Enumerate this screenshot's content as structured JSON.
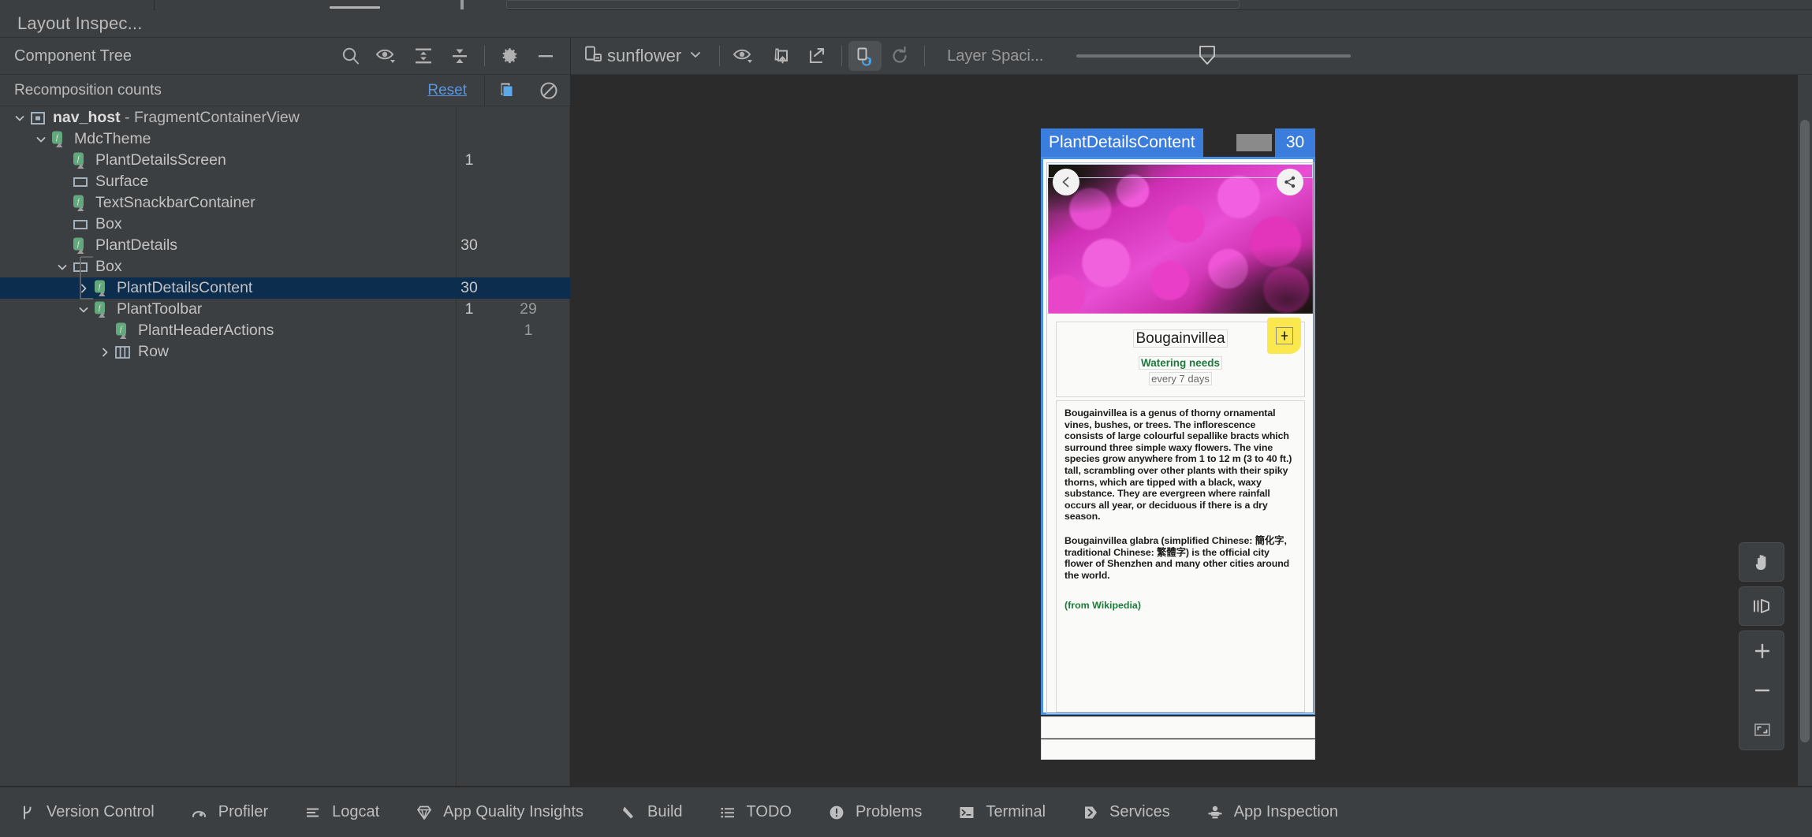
{
  "window": {
    "title": "Layout Inspec..."
  },
  "left_panel": {
    "header": "Component Tree",
    "toolbar": [
      {
        "name": "search-icon",
        "label": "Search"
      },
      {
        "name": "eye-dropdown-icon",
        "label": "Filter visibility"
      },
      {
        "name": "expand-all-icon",
        "label": "Expand All"
      },
      {
        "name": "collapse-all-icon",
        "label": "Collapse All"
      },
      {
        "name": "gear-icon",
        "label": "Settings"
      },
      {
        "name": "minimize-icon",
        "label": "Hide"
      }
    ],
    "recomposition": {
      "label": "Recomposition counts",
      "reset_label": "Reset",
      "highlight_icon": "recomposition-highlight-icon",
      "disable_icon": "recomposition-disable-icon"
    },
    "tree": [
      {
        "label": "nav_host",
        "suffix": " - FragmentContainerView",
        "icon": "view-node-icon",
        "depth": 0,
        "chevron": "down",
        "bold": true,
        "count1": "",
        "count2": ""
      },
      {
        "label": "MdcTheme",
        "suffix": "",
        "icon": "compose-node-icon",
        "depth": 1,
        "chevron": "down",
        "bold": false,
        "count1": "",
        "count2": ""
      },
      {
        "label": "PlantDetailsScreen",
        "suffix": "",
        "icon": "compose-node-icon",
        "depth": 2,
        "chevron": "none",
        "bold": false,
        "count1": "1",
        "count2": ""
      },
      {
        "label": "Surface",
        "suffix": "",
        "icon": "layout-node-icon",
        "depth": 2,
        "chevron": "none",
        "bold": false,
        "count1": "",
        "count2": ""
      },
      {
        "label": "TextSnackbarContainer",
        "suffix": "",
        "icon": "compose-node-icon",
        "depth": 2,
        "chevron": "none",
        "bold": false,
        "count1": "",
        "count2": ""
      },
      {
        "label": "Box",
        "suffix": "",
        "icon": "layout-node-icon",
        "depth": 2,
        "chevron": "none",
        "bold": false,
        "count1": "",
        "count2": ""
      },
      {
        "label": "PlantDetails",
        "suffix": "",
        "icon": "compose-node-icon",
        "depth": 2,
        "chevron": "none",
        "bold": false,
        "count1": "30",
        "count2": ""
      },
      {
        "label": "Box",
        "suffix": "",
        "icon": "layout-node-icon",
        "depth": 2,
        "chevron": "down",
        "bold": false,
        "count1": "",
        "count2": ""
      },
      {
        "label": "PlantDetailsContent",
        "suffix": "",
        "icon": "compose-node-icon",
        "depth": 3,
        "chevron": "right",
        "bold": false,
        "selected": true,
        "count1": "30",
        "count2": ""
      },
      {
        "label": "PlantToolbar",
        "suffix": "",
        "icon": "compose-node-icon",
        "depth": 3,
        "chevron": "down",
        "bold": false,
        "count1": "1",
        "count2": "29"
      },
      {
        "label": "PlantHeaderActions",
        "suffix": "",
        "icon": "compose-node-icon",
        "depth": 4,
        "chevron": "none",
        "bold": false,
        "count1": "",
        "count2": "1"
      },
      {
        "label": "Row",
        "suffix": "",
        "icon": "row-node-icon",
        "depth": 4,
        "chevron": "right",
        "bold": false,
        "count1": "",
        "count2": ""
      }
    ]
  },
  "canvas_toolbar": {
    "device_name": "sunflower",
    "device_icon": "device-icon",
    "chevron_icon": "chevron-down-icon",
    "buttons": [
      {
        "name": "view-options-icon",
        "label": "View options"
      },
      {
        "name": "load-overlay-icon",
        "label": "Load overlay"
      },
      {
        "name": "snapshot-icon",
        "label": "Export snapshot"
      },
      {
        "name": "live-updates-icon",
        "label": "Live updates",
        "active": true
      },
      {
        "name": "refresh-icon",
        "label": "Refresh",
        "disabled": true
      }
    ],
    "layer_spacing_label": "Layer Spaci...",
    "layer_spacing_value": 45
  },
  "canvas": {
    "overlay": {
      "node_label": "PlantDetailsContent",
      "recomposition_badge": "30",
      "accent_color": "#3b7ddd"
    },
    "preview": {
      "back_icon": "back-arrow-icon",
      "share_icon": "share-icon",
      "fab_icon": "add-icon",
      "plant_name": "Bougainvillea",
      "watering_label": "Watering needs",
      "watering_value": "every 7 days",
      "description_1": "Bougainvillea is a genus of thorny ornamental vines, bushes, or trees. The inflorescence consists of large colourful sepallike bracts which surround three simple waxy flowers. The vine species grow anywhere from 1 to 12 m (3 to 40 ft.) tall, scrambling over other plants with their spiky thorns, which are tipped with a black, waxy substance. They are evergreen where rainfall occurs all year, or deciduous if there is a dry season.",
      "description_2": "Bougainvillea glabra (simplified Chinese: 簡化字, traditional Chinese: 繁體字) is the official city flower of Shenzhen and many other cities around the world.",
      "credit": "(from Wikipedia)"
    }
  },
  "float_tools": [
    {
      "name": "pan-tool-icon",
      "label": "Pan"
    },
    {
      "name": "rotate-3d-icon",
      "label": "3D mode"
    },
    {
      "name": "zoom-in-icon",
      "label": "Zoom in"
    },
    {
      "name": "zoom-out-icon",
      "label": "Zoom out"
    },
    {
      "name": "zoom-to-fit-icon",
      "label": "Zoom to fit"
    }
  ],
  "statusbar": [
    {
      "label": "Version Control",
      "icon": "branch-icon"
    },
    {
      "label": "Profiler",
      "icon": "profiler-icon"
    },
    {
      "label": "Logcat",
      "icon": "logcat-icon"
    },
    {
      "label": "App Quality Insights",
      "icon": "gem-icon"
    },
    {
      "label": "Build",
      "icon": "hammer-icon"
    },
    {
      "label": "TODO",
      "icon": "list-icon"
    },
    {
      "label": "Problems",
      "icon": "warning-icon"
    },
    {
      "label": "Terminal",
      "icon": "terminal-icon"
    },
    {
      "label": "Services",
      "icon": "services-icon"
    },
    {
      "label": "App Inspection",
      "icon": "inspection-icon"
    }
  ]
}
